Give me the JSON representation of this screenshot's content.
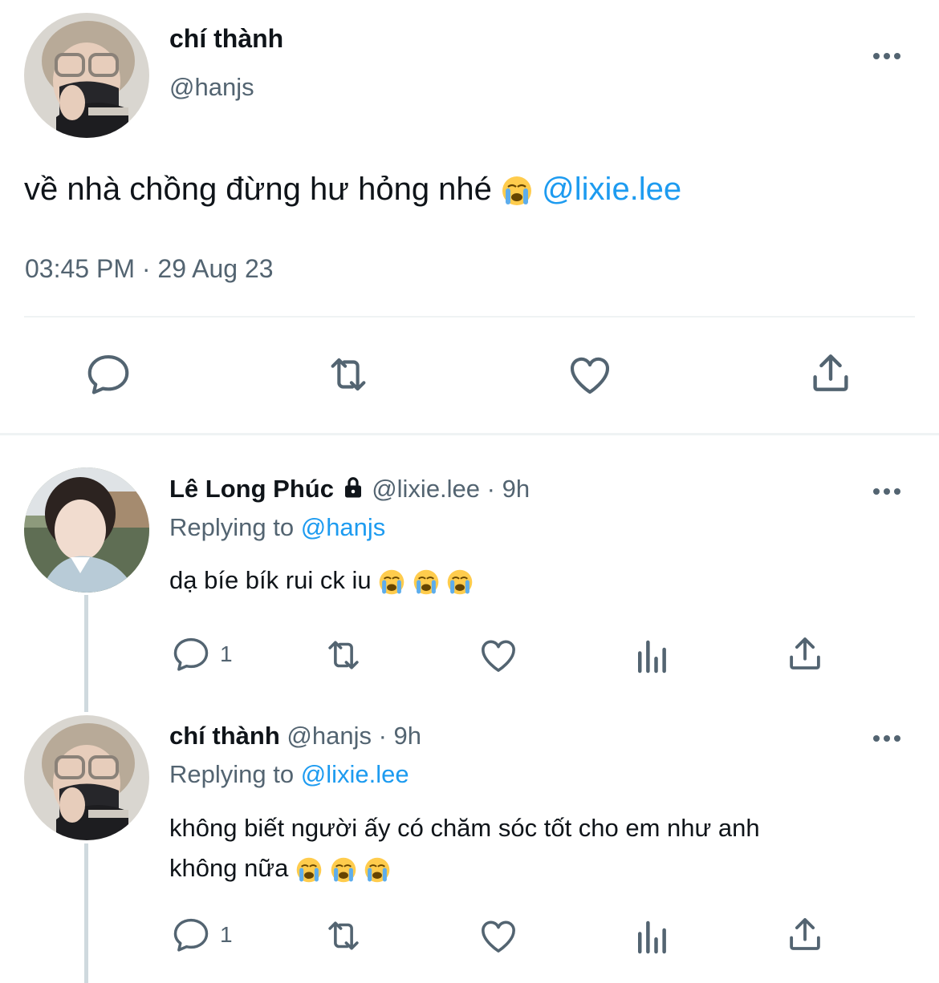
{
  "main_tweet": {
    "author": {
      "name": "chí thành",
      "handle": "@hanjs"
    },
    "text": "về nhà chồng đừng hư hỏng nhé",
    "emoji": "loudly-crying-face",
    "mention": "@lixie.lee",
    "timestamp": "03:45 PM · 29 Aug 23",
    "actions": [
      "reply-icon",
      "retweet-icon",
      "like-icon",
      "share-icon"
    ]
  },
  "replies": [
    {
      "author": {
        "name": "Lê Long Phúc",
        "handle": "@lixie.lee",
        "protected_icon": "lock-icon"
      },
      "time": "· 9h",
      "replying_label": "Replying to",
      "replying_to": "@hanjs",
      "text": "dạ bíe bík rui ck iu",
      "emoji_count": 3,
      "reply_count": "1"
    },
    {
      "author": {
        "name": "chí thành",
        "handle": "@hanjs"
      },
      "time": "· 9h",
      "replying_label": "Replying to",
      "replying_to": "@lixie.lee",
      "text_line1": "không biết người ấy có chăm sóc tốt cho em như anh",
      "text_line2": "không nữa",
      "emoji_count": 3,
      "reply_count": "1"
    }
  ],
  "colors": {
    "link": "#1d9bf0",
    "muted": "#536471",
    "divider": "#eff3f4"
  }
}
